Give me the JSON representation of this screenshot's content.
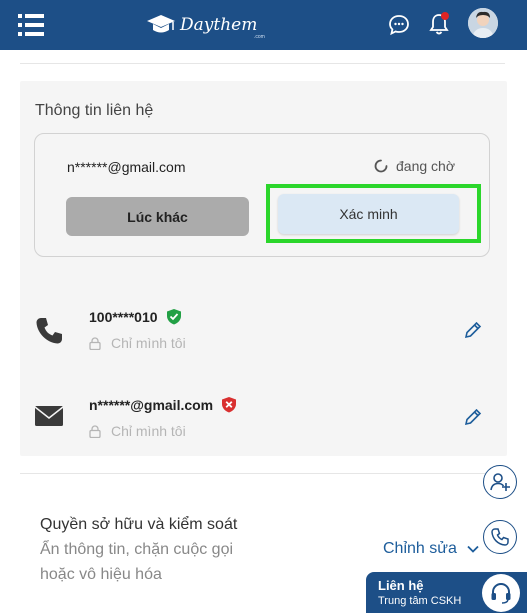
{
  "header": {
    "logo_text": "Daythem",
    "logo_sub": ".com",
    "menu_icon": "hamburger-menu-icon",
    "chat_icon": "chat-bubble-icon",
    "bell_icon": "bell-icon",
    "colors": {
      "bar": "#1d4f87",
      "notification_dot": "#e02424"
    }
  },
  "contact": {
    "section_title": "Thông tin liên hệ",
    "pending": {
      "email": "n******@gmail.com",
      "status": "đang chờ",
      "later_button": "Lúc khác",
      "verify_button": "Xác minh"
    },
    "items": [
      {
        "icon": "phone-icon",
        "value": "100****010",
        "badge": "verified-shield-icon",
        "badge_color": "#22a045",
        "privacy": "Chỉ mình tôi"
      },
      {
        "icon": "envelope-icon",
        "value": "n******@gmail.com",
        "badge": "unverified-shield-icon",
        "badge_color": "#d93030",
        "privacy": "Chỉ mình tôi"
      }
    ]
  },
  "ownership": {
    "title": "Quyền sở hữu và kiểm soát",
    "desc_line1": "Ẩn thông tin, chặn cuộc gọi",
    "desc_line2": "hoặc vô hiệu hóa",
    "edit_label": "Chỉnh sửa"
  },
  "floating": {
    "add_friend_icon": "add-user-icon",
    "call_icon": "phone-call-icon",
    "support_title": "Liên hệ",
    "support_subtitle": "Trung tâm CSKH",
    "support_icon": "headset-icon"
  }
}
